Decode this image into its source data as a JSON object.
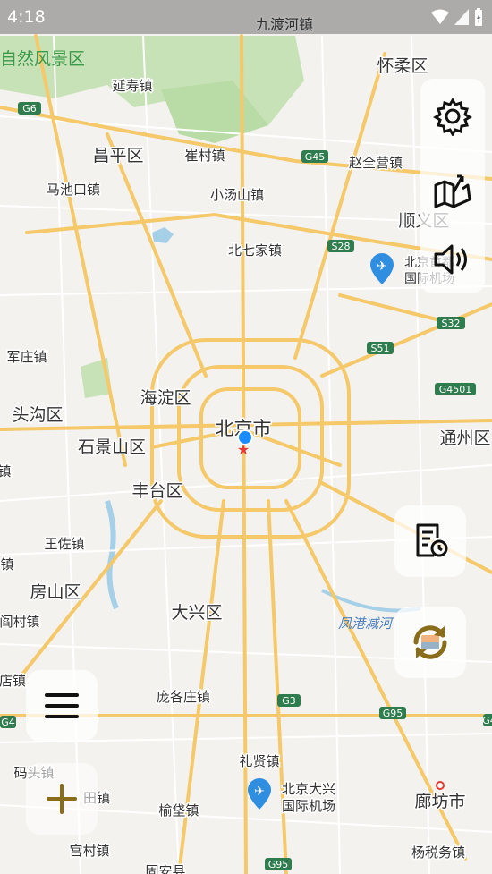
{
  "status_bar": {
    "time": "4:18"
  },
  "map": {
    "labels": [
      {
        "id": "jiuduhe",
        "text": "九渡河镇"
      },
      {
        "id": "nature",
        "text": "自然风景区"
      },
      {
        "id": "huairou",
        "text": "怀柔区"
      },
      {
        "id": "yanshou",
        "text": "延寿镇"
      },
      {
        "id": "changping",
        "text": "昌平区"
      },
      {
        "id": "cuicun",
        "text": "崔村镇"
      },
      {
        "id": "zhaoquanying",
        "text": "赵全营镇"
      },
      {
        "id": "machikou",
        "text": "马池口镇"
      },
      {
        "id": "xiaotangshan",
        "text": "小汤山镇"
      },
      {
        "id": "shunyi",
        "text": "顺义区"
      },
      {
        "id": "beiqijia",
        "text": "北七家镇"
      },
      {
        "id": "airport_cap",
        "text": "北京首都"
      },
      {
        "id": "airport_cap2",
        "text": "国际机场"
      },
      {
        "id": "junzhuang",
        "text": "军庄镇"
      },
      {
        "id": "haidian",
        "text": "海淀区"
      },
      {
        "id": "toutougou",
        "text": "头沟区"
      },
      {
        "id": "beijing",
        "text": "北京市"
      },
      {
        "id": "tongzhou",
        "text": "通州区"
      },
      {
        "id": "shijingshan",
        "text": "石景山区"
      },
      {
        "id": "zhen_left",
        "text": "镇"
      },
      {
        "id": "fengtai",
        "text": "丰台区"
      },
      {
        "id": "wangzuo",
        "text": "王佐镇"
      },
      {
        "id": "zhen_left2",
        "text": "镇"
      },
      {
        "id": "fangshan",
        "text": "房山区"
      },
      {
        "id": "daxing",
        "text": "大兴区"
      },
      {
        "id": "fenggang",
        "text": "凤港减河"
      },
      {
        "id": "yancun",
        "text": "阎村镇"
      },
      {
        "id": "dianzhen",
        "text": "店镇"
      },
      {
        "id": "pangezhuang",
        "text": "庞各庄镇"
      },
      {
        "id": "lixian",
        "text": "礼贤镇"
      },
      {
        "id": "matou",
        "text": "码头镇"
      },
      {
        "id": "airport_dx",
        "text": "北京大兴"
      },
      {
        "id": "airport_dx2",
        "text": "国际机场"
      },
      {
        "id": "langfang",
        "text": "廊坊市"
      },
      {
        "id": "gucheng",
        "text": "田镇"
      },
      {
        "id": "yudian",
        "text": "榆垡镇"
      },
      {
        "id": "gongcun",
        "text": "宫村镇"
      },
      {
        "id": "yangshuiwu",
        "text": "杨税务镇"
      },
      {
        "id": "gugu",
        "text": "固安县"
      }
    ],
    "road_shields": [
      {
        "id": "g6",
        "text": "G6"
      },
      {
        "id": "g45",
        "text": "G45"
      },
      {
        "id": "s28",
        "text": "S28"
      },
      {
        "id": "s32",
        "text": "S32"
      },
      {
        "id": "s51",
        "text": "S51"
      },
      {
        "id": "g4501",
        "text": "G4501"
      },
      {
        "id": "g3",
        "text": "G3"
      },
      {
        "id": "g95",
        "text": "G95"
      },
      {
        "id": "g4",
        "text": "G4"
      },
      {
        "id": "g95b",
        "text": "G95"
      },
      {
        "id": "g4b",
        "text": "G4"
      }
    ]
  },
  "controls": {
    "settings": "gear-icon",
    "route_upload": "route-icon",
    "volume": "speaker-icon",
    "history": "history-icon",
    "refresh": "refresh-icon",
    "menu": "menu-icon",
    "add": "plus-icon"
  },
  "colors": {
    "road_major": "#f5c86a",
    "road_minor": "#ffffff",
    "water": "#a6cfe8",
    "park": "#c6e3b5",
    "accent_gold": "#8a6d1a",
    "location_blue": "#1a8cff",
    "marker_red": "#e53935"
  }
}
